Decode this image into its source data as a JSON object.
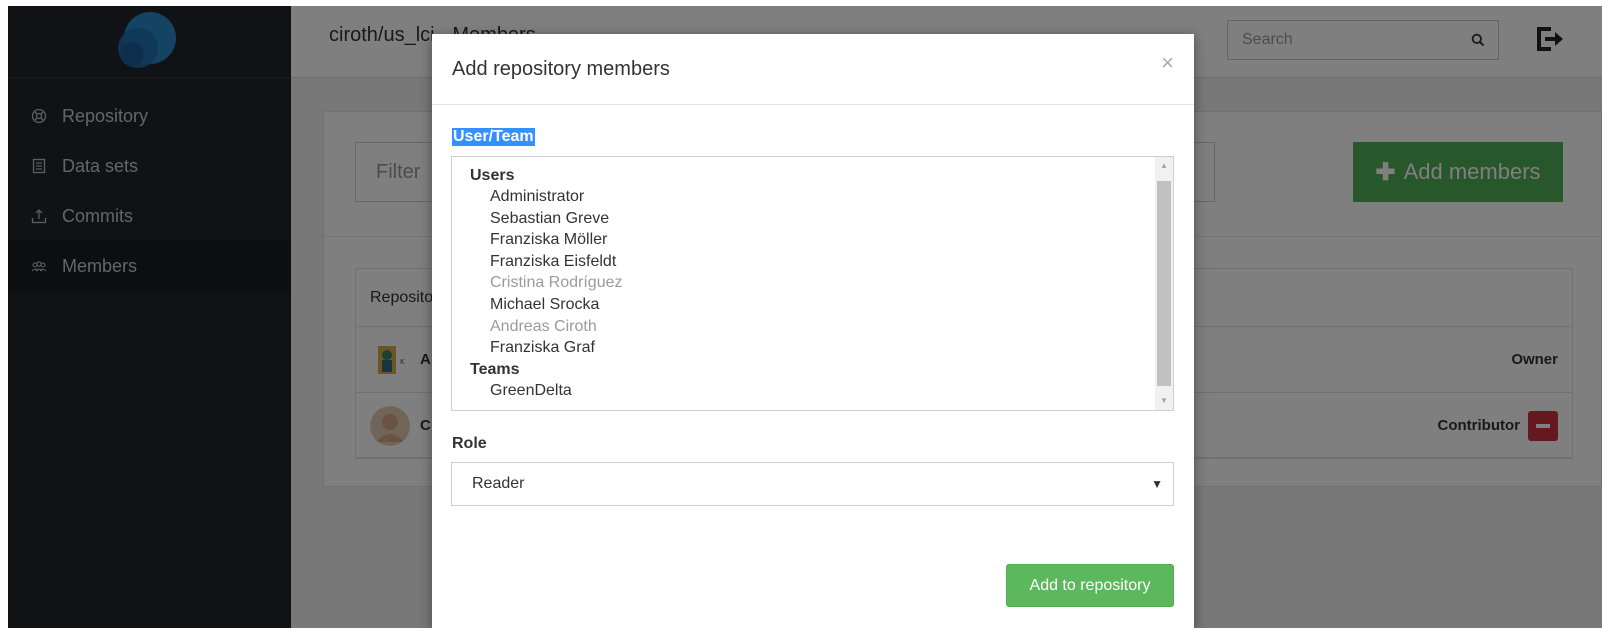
{
  "sidebar": {
    "items": [
      {
        "label": "Repository",
        "icon": "repository-icon"
      },
      {
        "label": "Data sets",
        "icon": "datasets-icon"
      },
      {
        "label": "Commits",
        "icon": "commits-icon"
      },
      {
        "label": "Members",
        "icon": "members-icon",
        "active": true
      }
    ]
  },
  "header": {
    "title": "ciroth/us_lci - Members",
    "search_placeholder": "Search"
  },
  "content": {
    "filter_placeholder": "Filter",
    "add_members_label": "Add members",
    "table_header": "Repository members",
    "rows": [
      {
        "name": "A",
        "role": "Owner"
      },
      {
        "name": "C",
        "role": "Contributor"
      }
    ]
  },
  "modal": {
    "title": "Add repository members",
    "close_glyph": "×",
    "user_team_label": "User/Team",
    "groups": [
      {
        "label": "Users",
        "options": [
          {
            "label": "Administrator",
            "disabled": false
          },
          {
            "label": "Sebastian Greve",
            "disabled": false
          },
          {
            "label": "Franziska Möller",
            "disabled": false
          },
          {
            "label": "Franziska Eisfeldt",
            "disabled": false
          },
          {
            "label": "Cristina Rodríguez",
            "disabled": true
          },
          {
            "label": "Michael Srocka",
            "disabled": false
          },
          {
            "label": "Andreas Ciroth",
            "disabled": true
          },
          {
            "label": "Franziska Graf",
            "disabled": false
          }
        ]
      },
      {
        "label": "Teams",
        "options": [
          {
            "label": "GreenDelta",
            "disabled": false
          }
        ]
      }
    ],
    "role_label": "Role",
    "role_value": "Reader",
    "submit_label": "Add to repository"
  },
  "colors": {
    "sidebar_bg": "#22252b",
    "primary_green": "#4fae57",
    "danger_red": "#c8333d",
    "selection_blue": "#3390ff"
  }
}
